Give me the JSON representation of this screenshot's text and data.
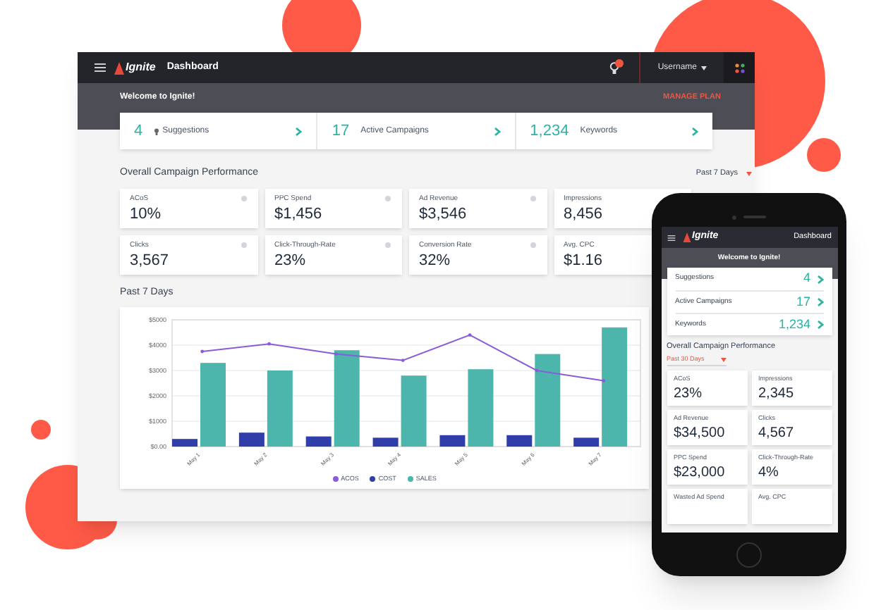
{
  "desktop": {
    "topbar": {
      "brand": "Ignite",
      "title": "Dashboard",
      "user": "Username"
    },
    "welcome": {
      "text": "Welcome to Ignite!",
      "action": "MANAGE PLAN"
    },
    "summary": [
      {
        "value": "4",
        "label": "Suggestions",
        "kind": "suggestion"
      },
      {
        "value": "17",
        "label": "Active Campaigns",
        "kind": "plain"
      },
      {
        "value": "1,234",
        "label": "Keywords",
        "kind": "plain"
      }
    ],
    "performance": {
      "title": "Overall Campaign Performance",
      "period": "Past 7 Days",
      "metrics": [
        {
          "label": "ACoS",
          "value": "10%"
        },
        {
          "label": "PPC Spend",
          "value": "$1,456"
        },
        {
          "label": "Ad Revenue",
          "value": "$3,546"
        },
        {
          "label": "Impressions",
          "value": "8,456"
        },
        {
          "label": "Clicks",
          "value": "3,567"
        },
        {
          "label": "Click-Through-Rate",
          "value": "23%"
        },
        {
          "label": "Conversion Rate",
          "value": "32%"
        },
        {
          "label": "Avg. CPC",
          "value": "$1.16"
        }
      ]
    },
    "chart_section": {
      "title": "Past 7 Days",
      "chart_data": {
        "type": "bar",
        "categories": [
          "May 1",
          "May 2",
          "May 3",
          "May 4",
          "May 5",
          "May 6",
          "May 7"
        ],
        "series": [
          {
            "name": "ACOS",
            "type": "line",
            "color": "#8a5cd8",
            "values": [
              3750,
              4050,
              3650,
              3400,
              4400,
              3000,
              2600
            ]
          },
          {
            "name": "COST",
            "type": "bar",
            "color": "#2f3ea8",
            "values": [
              300,
              550,
              400,
              350,
              450,
              450,
              350
            ]
          },
          {
            "name": "SALES",
            "type": "bar",
            "color": "#4db6ac",
            "values": [
              3300,
              3000,
              3800,
              2800,
              3050,
              3650,
              4700
            ]
          }
        ],
        "stacked": false,
        "grid": true,
        "legend": "bottom",
        "ylim": [
          0,
          5000
        ],
        "yticks": [
          {
            "value": 0,
            "label": "$0.00"
          },
          {
            "value": 1000,
            "label": "$1000"
          },
          {
            "value": 2000,
            "label": "$2000"
          },
          {
            "value": 3000,
            "label": "$3000"
          },
          {
            "value": 4000,
            "label": "$4000"
          },
          {
            "value": 5000,
            "label": "$5000"
          }
        ]
      }
    }
  },
  "phone": {
    "brand": "Ignite",
    "title": "Dashboard",
    "welcome": "Welcome to Ignite!",
    "summary": [
      {
        "label": "Suggestions",
        "value": "4"
      },
      {
        "label": "Active Campaigns",
        "value": "17"
      },
      {
        "label": "Keywords",
        "value": "1,234"
      }
    ],
    "performance": {
      "title": "Overall Campaign Performance",
      "period": "Past 30 Days",
      "metrics": [
        {
          "label": "ACoS",
          "value": "23%"
        },
        {
          "label": "Impressions",
          "value": "2,345"
        },
        {
          "label": "Ad Revenue",
          "value": "$34,500"
        },
        {
          "label": "Clicks",
          "value": "4,567"
        },
        {
          "label": "PPC Spend",
          "value": "$23,000"
        },
        {
          "label": "Click-Through-Rate",
          "value": "4%"
        },
        {
          "label": "Wasted Ad Spend"
        },
        {
          "label": "Avg. CPC"
        }
      ]
    }
  }
}
